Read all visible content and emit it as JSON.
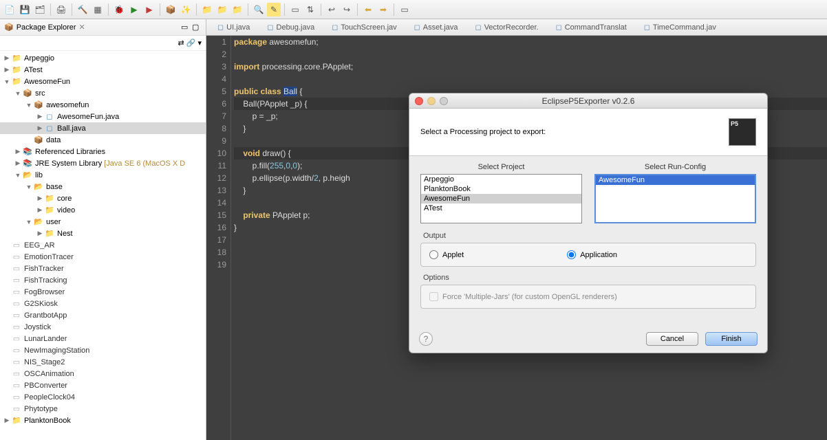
{
  "toolbar_icons": [
    "new",
    "save",
    "saveall",
    "print",
    "build",
    "debug-cfg",
    "run",
    "debug",
    "ext",
    "open",
    "open-type",
    "nav",
    "search",
    "ann",
    "task",
    "back",
    "fwd",
    "last"
  ],
  "package_explorer": {
    "title": "Package Explorer",
    "tree": [
      {
        "d": 0,
        "a": "r",
        "i": "proj",
        "t": "Arpeggio"
      },
      {
        "d": 0,
        "a": "r",
        "i": "proj",
        "t": "ATest"
      },
      {
        "d": 0,
        "a": "d",
        "i": "proj",
        "t": "AwesomeFun"
      },
      {
        "d": 1,
        "a": "d",
        "i": "pkg",
        "t": "src"
      },
      {
        "d": 2,
        "a": "d",
        "i": "pkg",
        "t": "awesomefun"
      },
      {
        "d": 3,
        "a": "r",
        "i": "jfile",
        "t": "AwesomeFun.java"
      },
      {
        "d": 3,
        "a": "r",
        "i": "jfile",
        "t": "Ball.java",
        "sel": true
      },
      {
        "d": 2,
        "a": "",
        "i": "pkg",
        "t": "data"
      },
      {
        "d": 1,
        "a": "r",
        "i": "lib",
        "t": "Referenced Libraries"
      },
      {
        "d": 1,
        "a": "r",
        "i": "lib",
        "t": "JRE System Library [Java SE 6 (MacOS X D"
      },
      {
        "d": 1,
        "a": "d",
        "i": "folder-open",
        "t": "lib"
      },
      {
        "d": 2,
        "a": "d",
        "i": "folder-open",
        "t": "base"
      },
      {
        "d": 3,
        "a": "r",
        "i": "folder",
        "t": "core"
      },
      {
        "d": 3,
        "a": "r",
        "i": "folder",
        "t": "video"
      },
      {
        "d": 2,
        "a": "d",
        "i": "folder-open",
        "t": "user"
      },
      {
        "d": 3,
        "a": "r",
        "i": "folder",
        "t": "Nest"
      },
      {
        "d": 0,
        "a": "",
        "i": "closed",
        "t": "EEG_AR"
      },
      {
        "d": 0,
        "a": "",
        "i": "closed",
        "t": "EmotionTracer"
      },
      {
        "d": 0,
        "a": "",
        "i": "closed",
        "t": "FishTracker"
      },
      {
        "d": 0,
        "a": "",
        "i": "closed",
        "t": "FishTracking"
      },
      {
        "d": 0,
        "a": "",
        "i": "closed",
        "t": "FogBrowser"
      },
      {
        "d": 0,
        "a": "",
        "i": "closed",
        "t": "G2SKiosk"
      },
      {
        "d": 0,
        "a": "",
        "i": "closed",
        "t": "GrantbotApp"
      },
      {
        "d": 0,
        "a": "",
        "i": "closed",
        "t": "Joystick"
      },
      {
        "d": 0,
        "a": "",
        "i": "closed",
        "t": "LunarLander"
      },
      {
        "d": 0,
        "a": "",
        "i": "closed",
        "t": "NewImagingStation"
      },
      {
        "d": 0,
        "a": "",
        "i": "closed",
        "t": "NIS_Stage2"
      },
      {
        "d": 0,
        "a": "",
        "i": "closed",
        "t": "OSCAnimation"
      },
      {
        "d": 0,
        "a": "",
        "i": "closed",
        "t": "PBConverter"
      },
      {
        "d": 0,
        "a": "",
        "i": "closed",
        "t": "PeopleClock04"
      },
      {
        "d": 0,
        "a": "",
        "i": "closed",
        "t": "Phytotype"
      },
      {
        "d": 0,
        "a": "r",
        "i": "proj",
        "t": "PlanktonBook"
      }
    ]
  },
  "editor_tabs": [
    "UI.java",
    "Debug.java",
    "TouchScreen.jav",
    "Asset.java",
    "VectorRecorder.",
    "CommandTranslat",
    "TimeCommand.jav"
  ],
  "code": {
    "lines": [
      {
        "n": 1,
        "html": "<span class='kw'>package</span> awesomefun;"
      },
      {
        "n": 2,
        "html": ""
      },
      {
        "n": 3,
        "html": "<span class='kw'>import</span> processing.core.PApplet;"
      },
      {
        "n": 4,
        "html": ""
      },
      {
        "n": 5,
        "html": "<span class='kw'>public class</span> <span class='hl'>Ball</span> {"
      },
      {
        "n": 6,
        "html": "    Ball(PApplet _p) {",
        "cur": true
      },
      {
        "n": 7,
        "html": "        p = _p;"
      },
      {
        "n": 8,
        "html": "    }"
      },
      {
        "n": 9,
        "html": ""
      },
      {
        "n": 10,
        "html": "    <span class='kw'>void</span> draw() {",
        "cur": true
      },
      {
        "n": 11,
        "html": "        p.fill(<span class='num'>255</span>,<span class='num'>0</span>,<span class='num'>0</span>);"
      },
      {
        "n": 12,
        "html": "        p.ellipse(p.width/<span class='num'>2</span>, p.heigh"
      },
      {
        "n": 13,
        "html": "    }"
      },
      {
        "n": 14,
        "html": ""
      },
      {
        "n": 15,
        "html": "    <span class='kw'>private</span> PApplet p;"
      },
      {
        "n": 16,
        "html": "}"
      },
      {
        "n": 17,
        "html": ""
      },
      {
        "n": 18,
        "html": ""
      },
      {
        "n": 19,
        "html": ""
      }
    ]
  },
  "dialog": {
    "title": "EclipseP5Exporter  v0.2.6",
    "banner": "Select a Processing project to export:",
    "select_project_label": "Select Project",
    "select_runconfig_label": "Select Run-Config",
    "projects": [
      "Arpeggio",
      "PlanktonBook",
      "AwesomeFun",
      "ATest"
    ],
    "selected_project": "AwesomeFun",
    "runconfigs": [
      "AwesomeFun"
    ],
    "selected_runconfig": "AwesomeFun",
    "output_label": "Output",
    "output_applet": "Applet",
    "output_application": "Application",
    "output_value": "Application",
    "options_label": "Options",
    "options_multijar": "Force 'Multiple-Jars' (for custom OpenGL renderers)",
    "options_multijar_checked": false,
    "cancel": "Cancel",
    "finish": "Finish"
  }
}
